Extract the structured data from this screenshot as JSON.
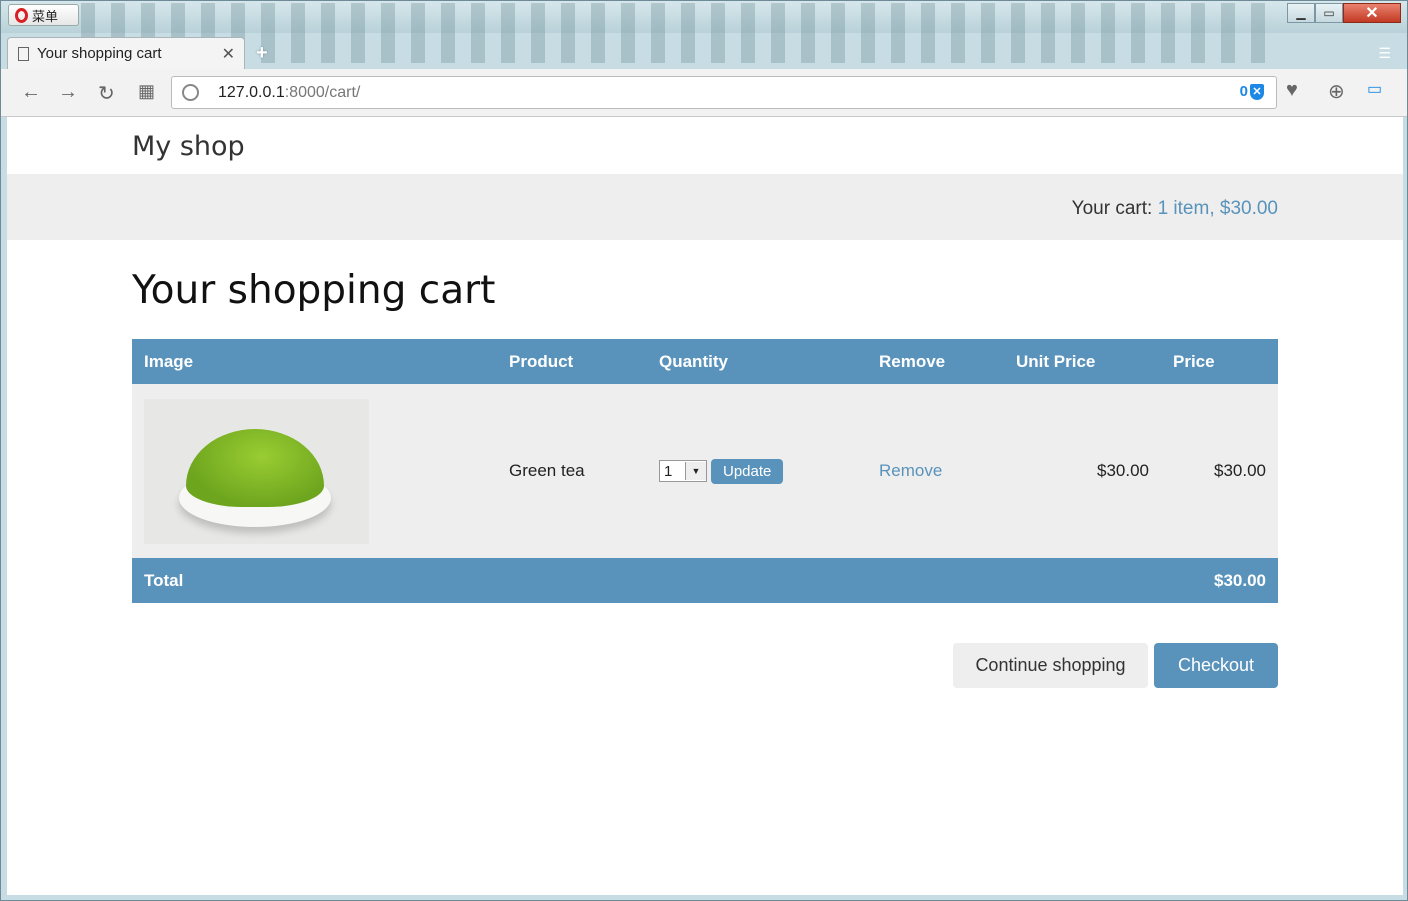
{
  "browser": {
    "menu_label": "菜单",
    "tab_title": "Your shopping cart",
    "url_host": "127.0.0.1",
    "url_rest": ":8000/cart/",
    "vpn_count": "0"
  },
  "shop": {
    "logo": "My shop",
    "cart_prefix": "Your cart: ",
    "cart_link": "1 item, $30.00"
  },
  "page": {
    "title": "Your shopping cart",
    "columns": [
      "Image",
      "Product",
      "Quantity",
      "Remove",
      "Unit Price",
      "Price"
    ],
    "items": [
      {
        "product": "Green tea",
        "quantity": "1",
        "update_label": "Update",
        "remove_label": "Remove",
        "unit_price": "$30.00",
        "price": "$30.00"
      }
    ],
    "total_label": "Total",
    "total_value": "$30.00",
    "continue_label": "Continue shopping",
    "checkout_label": "Checkout"
  },
  "colors": {
    "accent": "#5993bb",
    "subheader_bg": "#eeeeee"
  }
}
